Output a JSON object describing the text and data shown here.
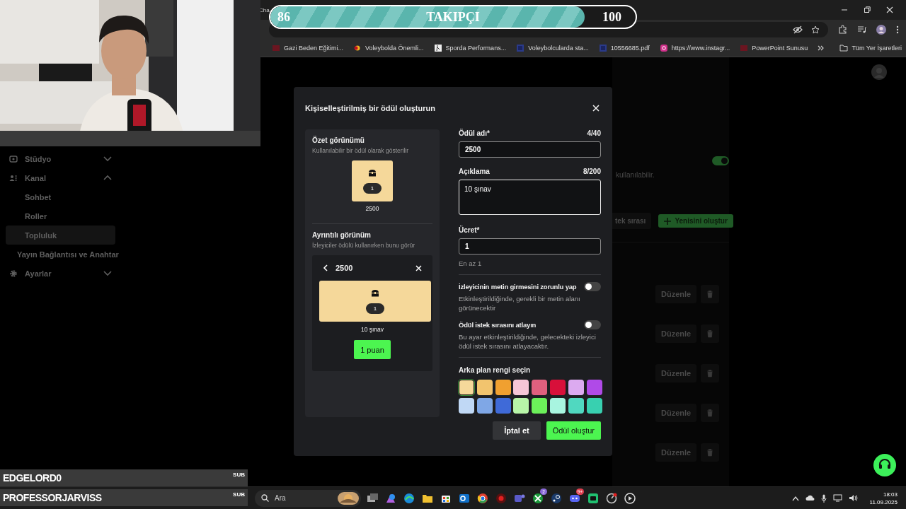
{
  "stream_overlay": {
    "follower_goal": {
      "current": "86",
      "label": "TAKIPÇI",
      "target": "100",
      "level": 0.86
    },
    "sub_alerts": [
      {
        "name": "EDGELORD0",
        "badge": "SUB"
      },
      {
        "name": "PROFESSORJARVISS",
        "badge": "SUB"
      }
    ]
  },
  "browser": {
    "tab_title": "Cha",
    "bookmarks": [
      "Gazi Beden Eğitimi...",
      "Voleybolda Önemli...",
      "Sporda Performans...",
      "Voleybolcularda sta...",
      "10556685.pdf",
      "https://www.instagr...",
      "PowerPoint Sunusu"
    ],
    "all_bookmarks": "Tüm Yer İşaretleri"
  },
  "sidebar": {
    "items": [
      {
        "label": "Stüdyo",
        "kind": "group",
        "expanded": false
      },
      {
        "label": "Kanal",
        "kind": "group",
        "expanded": true,
        "children": [
          {
            "label": "Sohbet",
            "selected": false
          },
          {
            "label": "Roller",
            "selected": false
          },
          {
            "label": "Topluluk",
            "selected": true
          }
        ]
      },
      {
        "label": "Yayın Bağlantısı ve Anahtar",
        "kind": "link"
      },
      {
        "label": "Ayarlar",
        "kind": "group",
        "expanded": false
      }
    ]
  },
  "background_page": {
    "enabled": true,
    "note": "kullanılabilir.",
    "queue_button": "tek sırası",
    "create_button": "Yenisini oluştur",
    "rows": [
      {
        "edit": "Düzenle"
      },
      {
        "edit": "Düzenle"
      },
      {
        "edit": "Düzenle"
      },
      {
        "edit": "Düzenle"
      },
      {
        "edit": "Düzenle"
      }
    ]
  },
  "dialog": {
    "title": "Kişiselleştirilmiş bir ödül oluşturun",
    "summary": {
      "title": "Özet görünümü",
      "subtitle": "Kullanılabilir bir ödül olarak gösterilir",
      "cost": "1",
      "name": "2500"
    },
    "detail": {
      "title": "Ayrıntılı görünüm",
      "subtitle": "İzleyiciler ödülü kullanırken bunu görür",
      "header": "2500",
      "cost": "1",
      "description": "10 şınav",
      "redeem_button": "1 puan"
    },
    "fields": [
      {
        "kind": "input",
        "label": "Ödül adı*",
        "counter": "4/40",
        "value": "2500"
      },
      {
        "kind": "textarea",
        "label": "Açıklama",
        "counter": "8/200",
        "value": "10 şınav"
      },
      {
        "kind": "input",
        "label": "Ücret*",
        "value": "1",
        "hint": "En az 1"
      }
    ],
    "toggles": [
      {
        "label": "İzleyicinin metin girmesini zorunlu yap",
        "description": "Etkinleştirildiğinde, gerekli bir metin alanı görünecektir",
        "on": false
      },
      {
        "label": "Ödül istek sırasını atlayın",
        "description": "Bu ayar etkinleştirildiğinde, gelecekteki izleyici ödül istek sırasını atlayacaktır.",
        "on": false
      }
    ],
    "color_picker": {
      "label": "Arka plan rengi seçin",
      "swatches": [
        {
          "color": "#f5d89a",
          "selected": true
        },
        {
          "color": "#f2c46e",
          "selected": false
        },
        {
          "color": "#f0a030",
          "selected": false
        },
        {
          "color": "#f5c6d6",
          "selected": false
        },
        {
          "color": "#e0607e",
          "selected": false
        },
        {
          "color": "#d8103a",
          "selected": false
        },
        {
          "color": "#dcaaf0",
          "selected": false
        },
        {
          "color": "#b04ae8",
          "selected": false
        },
        {
          "color": "#c0d8f5",
          "selected": false
        },
        {
          "color": "#7fa7e6",
          "selected": false
        },
        {
          "color": "#3f6ad8",
          "selected": false
        },
        {
          "color": "#b8f5a8",
          "selected": false
        },
        {
          "color": "#6cf05a",
          "selected": false
        },
        {
          "color": "#a8f5e0",
          "selected": false
        },
        {
          "color": "#50d8c0",
          "selected": false
        },
        {
          "color": "#38d0b0",
          "selected": false
        }
      ]
    },
    "buttons": {
      "cancel": "İptal et",
      "submit": "Ödül oluştur"
    }
  },
  "taskbar": {
    "search_placeholder": "Ara",
    "badges": [
      "2",
      "9+"
    ],
    "time": "18:03",
    "date": "11.09.2025"
  }
}
